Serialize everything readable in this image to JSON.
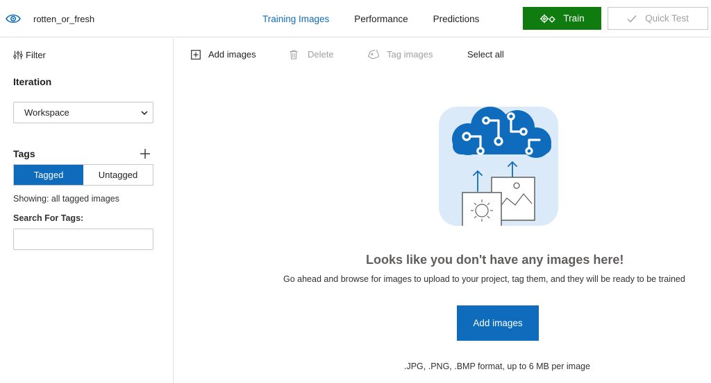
{
  "header": {
    "project_name": "rotten_or_fresh",
    "tabs": [
      {
        "label": "Training Images",
        "active": true
      },
      {
        "label": "Performance",
        "active": false
      },
      {
        "label": "Predictions",
        "active": false
      }
    ],
    "train_label": "Train",
    "quick_test_label": "Quick Test"
  },
  "sidebar": {
    "filter_label": "Filter",
    "iteration_heading": "Iteration",
    "iteration_selected": "Workspace",
    "tags_heading": "Tags",
    "toggle": {
      "tagged": "Tagged",
      "untagged": "Untagged",
      "selected": "Tagged"
    },
    "showing_text": "Showing: all tagged images",
    "search_label": "Search For Tags:",
    "search_value": ""
  },
  "toolbar": {
    "add_images": "Add images",
    "delete": "Delete",
    "tag_images": "Tag images",
    "select_all": "Select all"
  },
  "empty_state": {
    "title": "Looks like you don't have any images here!",
    "description": "Go ahead and browse for images to upload to your project, tag them, and they will be ready to be trained",
    "button_label": "Add images",
    "format_note": ".JPG, .PNG, .BMP format, up to 6 MB per image"
  },
  "icons": {
    "project": "eye-icon",
    "train": "gears-icon",
    "quick_test": "checkmark-icon",
    "filter": "filter-sliders-icon",
    "dropdown": "chevron-down-icon",
    "add_tag": "plus-icon",
    "add_images": "add-square-icon",
    "delete": "trash-icon",
    "tag_images": "tag-icon",
    "illustration": "cloud-upload-images-illustration"
  },
  "colors": {
    "accent_blue": "#0f6cbd",
    "train_green": "#107c10",
    "illustration_bg": "#daeaf8",
    "illustration_cloud": "#0f6cbd"
  }
}
